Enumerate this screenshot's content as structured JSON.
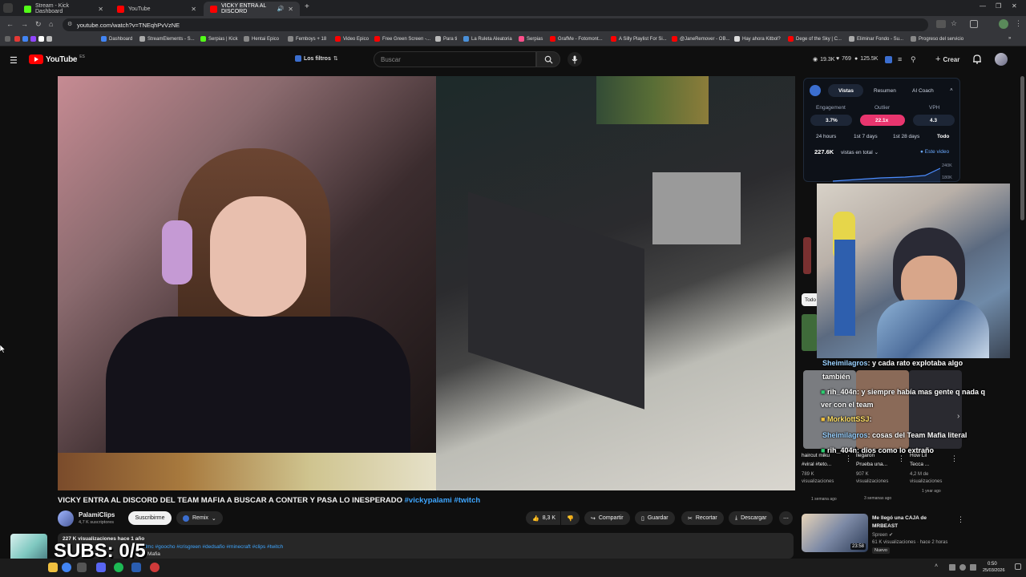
{
  "browser": {
    "tabs": [
      {
        "title": "Stream - Kick Dashboard",
        "favicon": "kick-icon",
        "color": "#53fc18"
      },
      {
        "title": "YouTube",
        "favicon": "youtube-icon",
        "color": "#ff0000"
      },
      {
        "title": "VICKY ENTRA AL DISCORD",
        "favicon": "youtube-icon",
        "color": "#ff0000"
      }
    ],
    "new_tab": "+",
    "url": "youtube.com/watch?v=TNEqhPvVzNE",
    "bookmarks": [
      "Dashboard",
      "StreamElements - S...",
      "Serpias | Kick",
      "Hentai Epico",
      "Femboys + 18",
      "Video Epico",
      "Free Green Screen -...",
      "Para ti",
      "La Ruleta Aleatoria",
      "Serpias",
      "GrafMe - Fotomont...",
      "A Silly Playlist For Si...",
      "@JaneRemover - OB...",
      "Hay ahora Kitbol?",
      "Dege of the Sky | C...",
      "Eliminar Fondo - Su...",
      "Progreso del servicio"
    ]
  },
  "youtube": {
    "logo": "YouTube",
    "region": "ES",
    "filters_label": "Los filtros",
    "search_placeholder": "Buscar",
    "header_stats": [
      "19.3K",
      "769",
      "125.5K"
    ],
    "create_label": "Crear"
  },
  "video": {
    "title": "VICKY ENTRA AL DISCORD DEL TEAM MAFIA A BUSCAR A CONTER Y PASA LO INESPERADO",
    "hashtags": "#vickypalami #twitch",
    "channel": "PalamiClips",
    "subscribers": "4,7 K suscriptores",
    "subscribe_label": "Suscribirme",
    "remix_label": "Remix",
    "likes": "8,3 K",
    "share_label": "Compartir",
    "save_label": "Guardar",
    "clip_label": "Recortar",
    "download_label": "Descargar",
    "views_line": "227 K visualizaciones  hace 1 año",
    "desc_tags": "#lmc #goocho #crisgreen #dedsafio #minecraft #clips #twitch",
    "desc_line2": "Mafia"
  },
  "extension": {
    "tabs": [
      "Vistas",
      "Resumen",
      "AI Coach"
    ],
    "metrics": [
      {
        "label": "Engagement",
        "value": "3.7%"
      },
      {
        "label": "Outlier",
        "value": "22.1x"
      },
      {
        "label": "VPH",
        "value": "4.3"
      }
    ],
    "ranges": [
      "24 hours",
      "1st 7 days",
      "1st 28 days",
      "Todo"
    ],
    "total_views": "227.6K",
    "total_label": "vistas en total",
    "this_video": "Este video",
    "y_ticks": [
      "240K",
      "180K"
    ]
  },
  "chat": [
    {
      "user": "Sheimilagros",
      "text": ": y cada rato explotaba algo"
    },
    {
      "user": "",
      "text": "también"
    },
    {
      "user": "rih_404n",
      "text": ": y siempre había mas gente q nada q"
    },
    {
      "user": "",
      "text": "ver con el team"
    },
    {
      "user": "MorklottSSJ",
      "text": ": "
    },
    {
      "user": "Sheimilagros",
      "text": ": cosas del Team Mafia literal"
    },
    {
      "user": "rih_404n",
      "text": ": dios como lo extraño"
    }
  ],
  "recs": [
    {
      "title": "haircut miku",
      "sub": "#viral #teto...",
      "views": "789 K",
      "views_label": "visualizaciones",
      "age": "1 semana ago"
    },
    {
      "title": "llegaron",
      "sub": "Prueba una...",
      "views": "907 K",
      "views_label": "visualizaciones",
      "age": "3 semanas ago"
    },
    {
      "title": "How Lil",
      "sub": "Tecca ...",
      "views": "4,2 M de",
      "views_label": "visualizaciones",
      "age": "1 year ago"
    }
  ],
  "rec_video": {
    "title": "Me llegó una CAJA de",
    "title2": "MRBEAST",
    "channel": "Spreen",
    "meta": "61 K visualizaciones · hace 2 horas",
    "badge": "Nuevo",
    "duration": "23:58"
  },
  "sidebar_chip": "Todo",
  "overlay": {
    "subs": "SUBS: 0/5"
  },
  "taskbar": {
    "time": "0:50",
    "date": "25/03/2026"
  }
}
